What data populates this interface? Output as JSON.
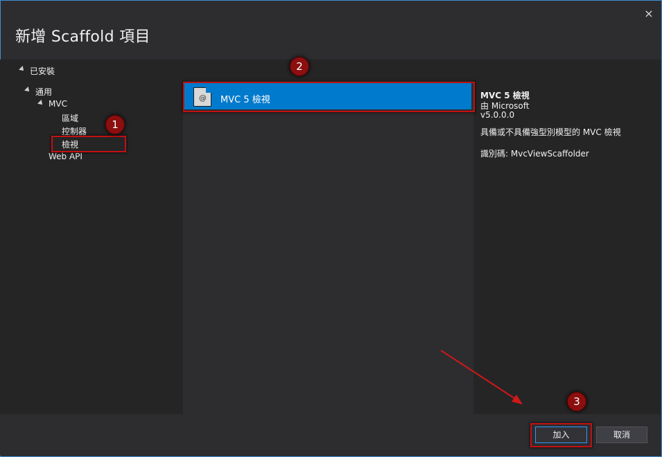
{
  "dialog": {
    "title": "新增 Scaffold 項目",
    "close_symbol": "×"
  },
  "tree": {
    "installed": "已安裝",
    "common": "通用",
    "mvc": "MVC",
    "area": "區域",
    "controller": "控制器",
    "view": "檢視",
    "webapi": "Web API"
  },
  "list": {
    "items": [
      {
        "label": "MVC 5 檢視",
        "icon": "razor-file-icon",
        "icon_glyph": "@"
      }
    ]
  },
  "details": {
    "name": "MVC 5 檢視",
    "by": "由 Microsoft",
    "version": "v5.0.0.0",
    "description": "具備或不具備強型別模型的  MVC 檢視",
    "id": "識別碼: MvcViewScaffolder"
  },
  "footer": {
    "add_label": "加入",
    "cancel_label": "取消"
  },
  "annotations": {
    "step1": "1",
    "step2": "2",
    "step3": "3",
    "highlight_color": "#c41010"
  }
}
